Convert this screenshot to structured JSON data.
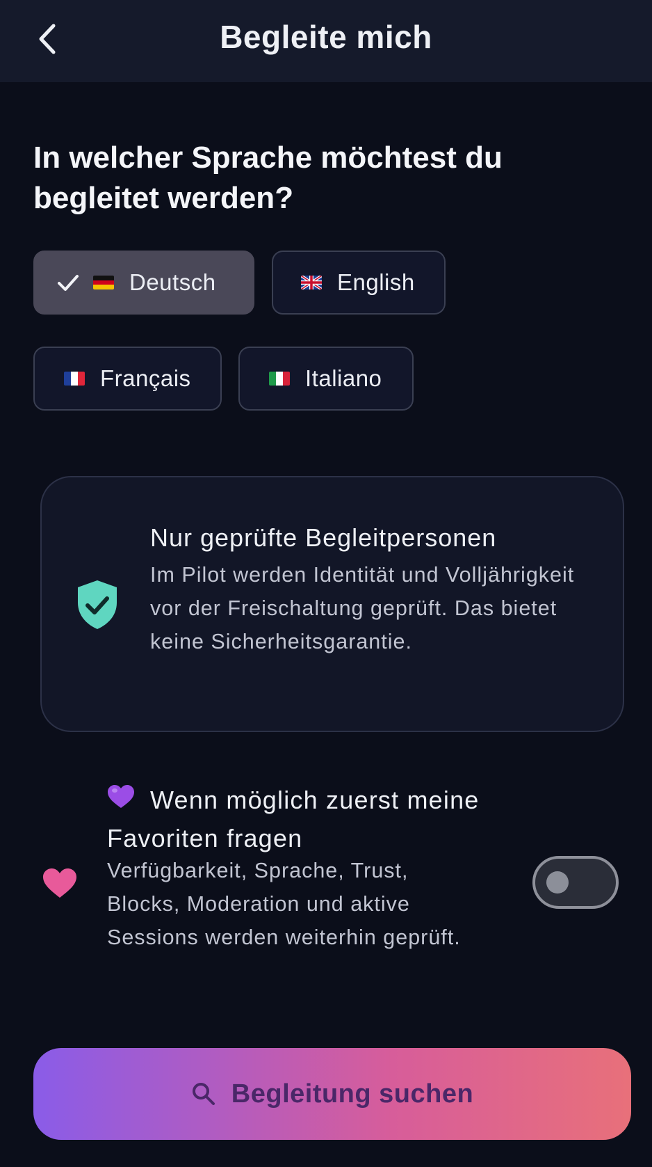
{
  "header": {
    "title": "Begleite mich",
    "back_icon": "chevron-left-icon"
  },
  "question": "In welcher Sprache möchtest du begleitet werden?",
  "languages": [
    {
      "label": "Deutsch",
      "flag": "flag-germany-icon",
      "selected": true
    },
    {
      "label": "English",
      "flag": "flag-uk-icon",
      "selected": false
    },
    {
      "label": "Français",
      "flag": "flag-france-icon",
      "selected": false
    },
    {
      "label": "Italiano",
      "flag": "flag-italy-icon",
      "selected": false
    }
  ],
  "info_card": {
    "icon": "shield-check-icon",
    "title": "Nur geprüfte Begleitpersonen",
    "text": "Im Pilot werden Identität und Volljährigkeit vor der Freischaltung geprüft. Das bietet keine Sicherheitsgarantie."
  },
  "favorites": {
    "icon": "heart-icon",
    "emoji": "purple-heart-icon",
    "title": "Wenn möglich zuerst meine Favoriten fragen",
    "text": "Verfügbarkeit, Sprache, Trust, Blocks, Moderation und aktive Sessions werden weiterhin geprüft.",
    "toggle_on": false
  },
  "search_button": {
    "label": "Begleitung suchen",
    "icon": "search-icon"
  },
  "colors": {
    "background": "#0b0e1a",
    "header": "#151a2b",
    "accent_teal": "#5fd6c0",
    "heart_pink": "#e85a9a",
    "gradient_start": "#8a5ce8",
    "gradient_end": "#e8707a"
  }
}
